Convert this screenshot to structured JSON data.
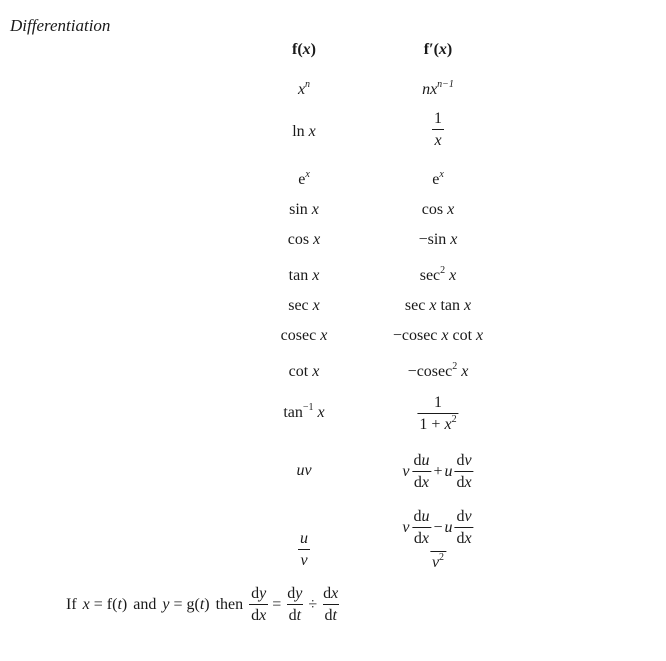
{
  "title": "Differentiation",
  "table": {
    "headers": {
      "f": "f(x)",
      "f_prime": "f′(x)"
    },
    "rows": [
      {
        "f": "x^n",
        "f_prime": "nx^(n−1)"
      },
      {
        "f": "ln x",
        "f_prime": "1/x"
      },
      {
        "f": "e^x",
        "f_prime": "e^x"
      },
      {
        "f": "sin x",
        "f_prime": "cos x"
      },
      {
        "f": "cos x",
        "f_prime": "−sin x"
      },
      {
        "f": "tan x",
        "f_prime": "sec² x"
      },
      {
        "f": "sec x",
        "f_prime": "sec x tan x"
      },
      {
        "f": "cosec x",
        "f_prime": "−cosec x cot x"
      },
      {
        "f": "cot x",
        "f_prime": "−cosec² x"
      },
      {
        "f": "tan⁻¹ x",
        "f_prime": "1/(1+x²)"
      },
      {
        "f": "uv",
        "f_prime": "v du/dx + u dv/dx"
      },
      {
        "f": "u/v",
        "f_prime": "(v du/dx − u dv/dx)/v²"
      }
    ]
  },
  "parametric": {
    "text": "If x = f(t) and y = g(t) then dy/dx = dy/dt ÷ dx/dt",
    "if": "If",
    "and": "and",
    "then": "then"
  },
  "sym": {
    "x": "x",
    "n": "n",
    "nm1": "n−1",
    "e": "e",
    "one": "1",
    "two": "2",
    "m1": "−1",
    "ln": "ln",
    "sin": "sin",
    "cos": "cos",
    "tan": "tan",
    "sec": "sec",
    "cosec": "cosec",
    "cot": "cot",
    "minus": "−",
    "plus": "+",
    "eq": "=",
    "div": "÷",
    "u": "u",
    "v": "v",
    "du": "du",
    "dv": "dv",
    "dx": "dx",
    "dy": "dy",
    "dt": "dt",
    "onepx": "1 + x",
    "f_open": "f(",
    "g_open": "g(",
    "t": "t",
    "close": ")",
    "fx_f": "f",
    "fx_fp": "f′",
    "open": "("
  }
}
